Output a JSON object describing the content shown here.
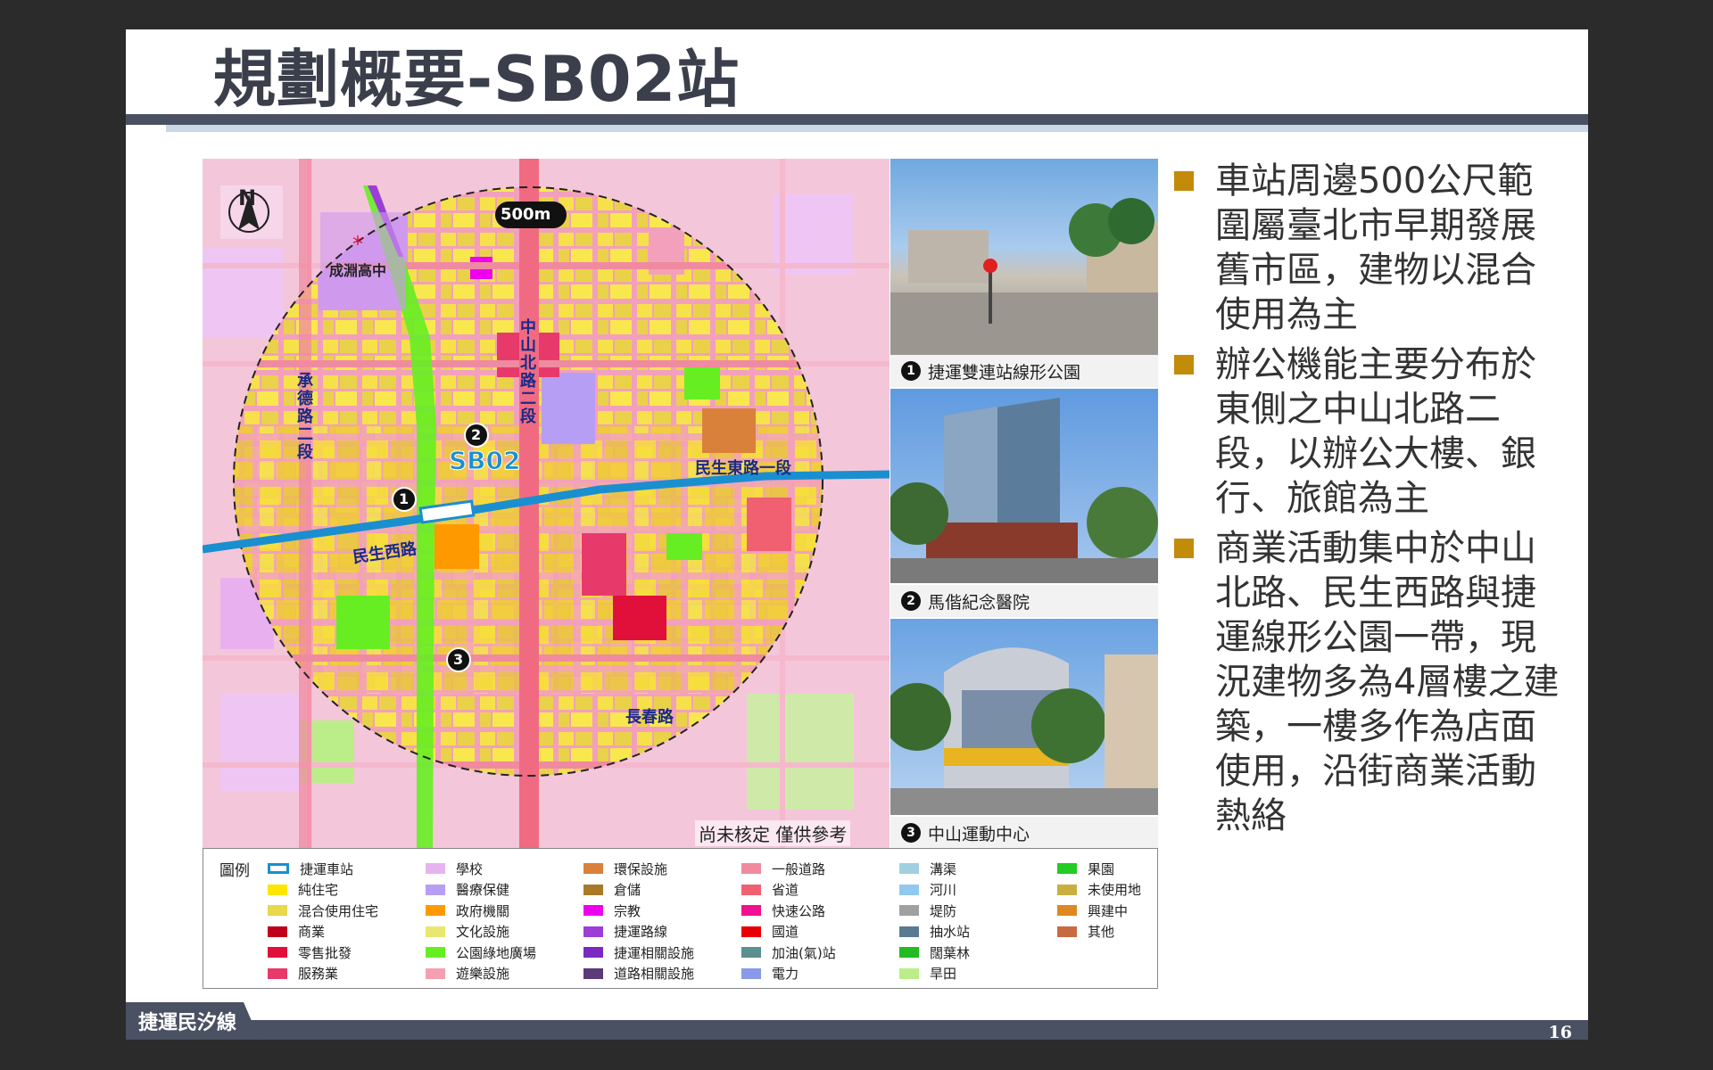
{
  "slide": {
    "title": "規劃概要-SB02站",
    "footer_label": "捷運民汐線",
    "page_number": "16"
  },
  "map": {
    "north_label": "N",
    "radius_label": "500m",
    "station_label": "SB02",
    "disclaimer": "尚未核定 僅供參考",
    "school_label": "成淵高中",
    "roads": {
      "chengde": "承德路二段",
      "zhongshan": "中山北路二段",
      "minsheng_west": "民生西路",
      "minsheng_east": "民生東路一段",
      "changchun": "長春路"
    },
    "markers": [
      "1",
      "2",
      "3"
    ]
  },
  "photos": [
    {
      "num": "1",
      "caption": "捷運雙連站線形公園"
    },
    {
      "num": "2",
      "caption": "馬偕紀念醫院"
    },
    {
      "num": "3",
      "caption": "中山運動中心"
    }
  ],
  "legend": {
    "title": "圖例",
    "items": [
      {
        "label": "捷運車站",
        "color": "#ffffff"
      },
      {
        "label": "純住宅",
        "color": "#ffe500"
      },
      {
        "label": "混合使用住宅",
        "color": "#e8d84a"
      },
      {
        "label": "商業",
        "color": "#c0001a"
      },
      {
        "label": "零售批發",
        "color": "#e0103a"
      },
      {
        "label": "服務業",
        "color": "#e83a6a"
      },
      {
        "label": "學校",
        "color": "#e6b3f0"
      },
      {
        "label": "醫療保健",
        "color": "#b79ef5"
      },
      {
        "label": "政府機關",
        "color": "#ff9900"
      },
      {
        "label": "文化設施",
        "color": "#e8e870"
      },
      {
        "label": "公園綠地廣場",
        "color": "#66ee22"
      },
      {
        "label": "遊樂設施",
        "color": "#f5a0b0"
      },
      {
        "label": "環保設施",
        "color": "#d9813a"
      },
      {
        "label": "倉儲",
        "color": "#a87a28"
      },
      {
        "label": "宗教",
        "color": "#ee00ee"
      },
      {
        "label": "捷運路線",
        "color": "#9d3dd8"
      },
      {
        "label": "捷運相關設施",
        "color": "#7a2ac0"
      },
      {
        "label": "道路相關設施",
        "color": "#5a3a78"
      },
      {
        "label": "一般道路",
        "color": "#f08aa0"
      },
      {
        "label": "省道",
        "color": "#f06070"
      },
      {
        "label": "快速公路",
        "color": "#f01090"
      },
      {
        "label": "國道",
        "color": "#e80000"
      },
      {
        "label": "加油(氣)站",
        "color": "#5a9090"
      },
      {
        "label": "電力",
        "color": "#8a9ae8"
      },
      {
        "label": "溝渠",
        "color": "#a0d0e0"
      },
      {
        "label": "河川",
        "color": "#90c8f0"
      },
      {
        "label": "堤防",
        "color": "#a0a0a0"
      },
      {
        "label": "抽水站",
        "color": "#5a7a90"
      },
      {
        "label": "闊葉林",
        "color": "#22bb22"
      },
      {
        "label": "旱田",
        "color": "#bbee88"
      },
      {
        "label": "果園",
        "color": "#22cc22"
      },
      {
        "label": "未使用地",
        "color": "#c8b040"
      },
      {
        "label": "興建中",
        "color": "#e08820"
      },
      {
        "label": "其他",
        "color": "#c86a40"
      }
    ]
  },
  "bullets": [
    "車站周邊500公尺範圍屬臺北市早期發展舊市區，建物以混合使用為主",
    "辦公機能主要分布於東側之中山北路二段，以辦公大樓、銀行、旅館為主",
    "商業活動集中於中山北路、民生西路與捷運線形公園一帶，現況建物多為4層樓之建築，一樓多作為店面使用，沿街商業活動熱絡"
  ],
  "colors": {
    "title": "#3a3f4b",
    "bar": "#4a5162",
    "bullet_mark": "#c38b0a",
    "mrt_line": "#1a8fd0"
  }
}
